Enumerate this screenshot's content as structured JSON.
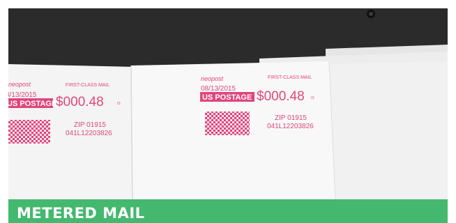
{
  "banner": {
    "label": "METERED MAIL",
    "color": "#43b86e"
  },
  "envelope_left": {
    "brand": "neopost",
    "service": "FIRST-CLASS MAIL",
    "date": "8/13/2015",
    "postage_label": "US POSTAGE",
    "amount": "$000.48",
    "amount_suffix": "IS",
    "zip": "ZIP 01915",
    "serial": "041L12203826"
  },
  "envelope_center": {
    "brand": "neopost",
    "service": "FIRST-CLASS MAIL",
    "date": "08/13/2015",
    "postage_label": "US POSTAGE",
    "amount": "$000.48",
    "amount_suffix": "IS",
    "zip": "ZIP 01915",
    "serial": "041L12203826"
  },
  "colors": {
    "meter_ink": "#e0467c",
    "desk": "#2b2b2b",
    "paper": "#f6f6f6"
  }
}
